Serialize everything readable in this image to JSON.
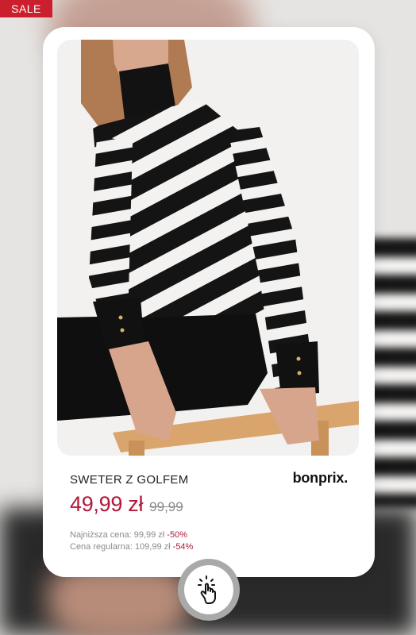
{
  "badge": {
    "label": "SALE",
    "color": "#cc1f2d"
  },
  "product": {
    "image_icon": "product-photo",
    "name": "SWETER Z GOLFEM",
    "brand": "bonprix.",
    "price_current": "49,99 zł",
    "price_old": "99,99",
    "lowest_price_label": "Najniższa cena: 99,99 zł",
    "lowest_price_discount": "-50%",
    "regular_price_label": "Cena regularna: 109,99 zł",
    "regular_price_discount": "-54%",
    "accent_color": "#b0193a"
  },
  "action": {
    "icon": "tap-hand-icon"
  }
}
